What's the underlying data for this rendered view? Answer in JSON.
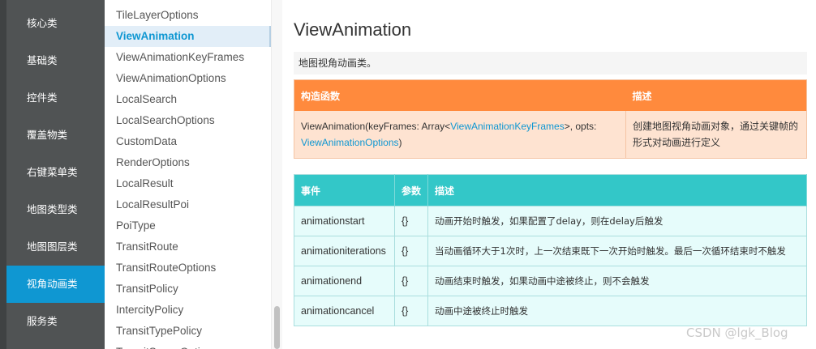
{
  "categories": [
    "核心类",
    "基础类",
    "控件类",
    "覆盖物类",
    "右键菜单类",
    "地图类型类",
    "地图图层类",
    "视角动画类",
    "服务类"
  ],
  "active_category": "视角动画类",
  "classes": [
    "TileLayerOptions",
    "ViewAnimation",
    "ViewAnimationKeyFrames",
    "ViewAnimationOptions",
    "LocalSearch",
    "LocalSearchOptions",
    "CustomData",
    "RenderOptions",
    "LocalResult",
    "LocalResultPoi",
    "PoiType",
    "TransitRoute",
    "TransitRouteOptions",
    "TransitPolicy",
    "IntercityPolicy",
    "TransitTypePolicy",
    "TransitSceneOptions"
  ],
  "active_class": "ViewAnimation",
  "page": {
    "title": "ViewAnimation",
    "description": "地图视角动画类。"
  },
  "constructor_table": {
    "headers": [
      "构造函数",
      "描述"
    ],
    "row": {
      "sig_prefix": "ViewAnimation(keyFrames: Array<",
      "sig_link1": "ViewAnimationKeyFrames",
      "sig_middle": ">, opts:",
      "sig_link2": "ViewAnimationOptions",
      "sig_suffix": ")",
      "desc": "创建地图视角动画对象，通过关键帧的形式对动画进行定义"
    }
  },
  "events_table": {
    "headers": [
      "事件",
      "参数",
      "描述"
    ],
    "rows": [
      {
        "event": "animationstart",
        "params": "{}",
        "desc": "动画开始时触发，如果配置了delay，则在delay后触发"
      },
      {
        "event": "animationiterations",
        "params": "{}",
        "desc": "当动画循环大于1次时，上一次结束既下一次开始时触发。最后一次循环结束时不触发"
      },
      {
        "event": "animationend",
        "params": "{}",
        "desc": "动画结束时触发，如果动画中途被终止，则不会触发"
      },
      {
        "event": "animationcancel",
        "params": "{}",
        "desc": "动画中途被终止时触发"
      }
    ]
  },
  "watermark": "CSDN @lgk_Blog",
  "colors": {
    "accent": "#0f97d2",
    "ctor_header": "#ff8a3d",
    "events_header": "#33c7c8"
  }
}
